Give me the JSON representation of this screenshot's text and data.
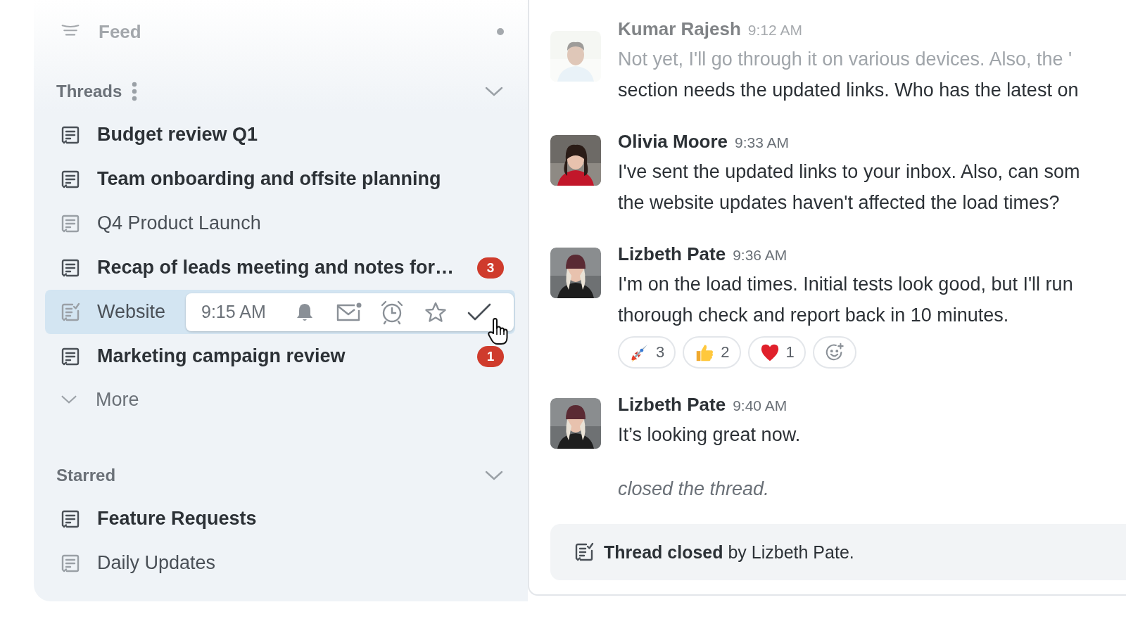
{
  "sidebar": {
    "feed": {
      "label": "Feed",
      "unread": true
    },
    "sections": [
      {
        "title": "Threads",
        "has_menu": true,
        "expanded": true,
        "items": [
          {
            "label": "Budget review Q1",
            "unread": true,
            "closed": false,
            "selected": false
          },
          {
            "label": "Team onboarding and offsite planning",
            "unread": true,
            "closed": false,
            "selected": false
          },
          {
            "label": "Q4 Product Launch",
            "unread": false,
            "closed": false,
            "selected": false
          },
          {
            "label": "Recap of leads meeting and notes for…",
            "unread": true,
            "closed": false,
            "selected": false,
            "count": "3"
          },
          {
            "label": "Website",
            "unread": false,
            "closed": true,
            "selected": true,
            "hover_time": "9:15 AM"
          },
          {
            "label": "Marketing campaign review",
            "unread": true,
            "closed": false,
            "selected": false,
            "count": "1"
          }
        ],
        "more": "More"
      },
      {
        "title": "Starred",
        "has_menu": false,
        "expanded": true,
        "items": [
          {
            "label": "Feature Requests",
            "unread": true,
            "closed": false,
            "selected": false
          },
          {
            "label": "Daily Updates",
            "unread": false,
            "closed": false,
            "selected": false
          }
        ]
      }
    ]
  },
  "messages": [
    {
      "author": "Kumar Rajesh",
      "time": "9:12 AM",
      "lines": [
        "Not yet, I'll go through it on various devices. Also, the '",
        "section needs the updated links. Who has the latest on"
      ]
    },
    {
      "author": "Olivia Moore",
      "time": "9:33 AM",
      "lines": [
        "I've sent the updated links to your inbox. Also, can som",
        "the website updates haven't affected the load times?"
      ]
    },
    {
      "author": "Lizbeth Pate",
      "time": "9:36 AM",
      "lines": [
        "I'm on the load times. Initial tests look good, but I'll run",
        "thorough check and report back in 10 minutes."
      ],
      "reactions": [
        {
          "kind": "rocket",
          "count": "3"
        },
        {
          "kind": "thumbs-up",
          "count": "2"
        },
        {
          "kind": "heart",
          "count": "1"
        },
        {
          "kind": "add"
        }
      ]
    },
    {
      "author": "Lizbeth Pate",
      "time": "9:40 AM",
      "lines": [
        "It’s looking great now."
      ]
    }
  ],
  "system_note": "closed the thread.",
  "closed_banner": "**Thread closed** by Lizbeth Pate."
}
